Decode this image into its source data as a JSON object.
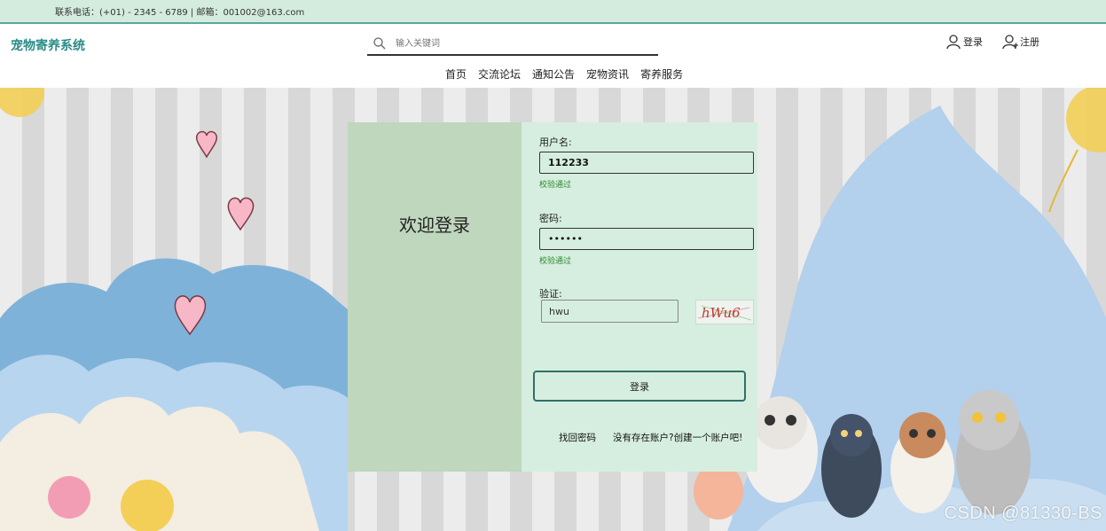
{
  "topbar": {
    "info": "联系电话：(+01) - 2345 - 6789 | 邮箱：001002@163.com"
  },
  "header": {
    "logo": "宠物寄养系统",
    "search_placeholder": "输入关键词",
    "login_label": "登录",
    "register_label": "注册"
  },
  "nav": [
    "首页",
    "交流论坛",
    "通知公告",
    "宠物资讯",
    "寄养服务"
  ],
  "card": {
    "welcome": "欢迎登录",
    "username_label": "用户名:",
    "username_value": "112233",
    "username_hint": "校验通过",
    "password_label": "密码:",
    "password_value": "••••••",
    "password_hint": "校验通过",
    "captcha_label": "验证:",
    "captcha_value": "hwu",
    "captcha_text": "hWu6",
    "login_button": "登录",
    "forgot_link": "找回密码",
    "register_link": "没有存在账户?创建一个账户吧!"
  },
  "watermark": "CSDN @81330-BS",
  "colors": {
    "brand": "#2a8c86",
    "topbar_bg": "#d4ecde",
    "card_left": "#bfd7bd",
    "card_right": "#d6eedf",
    "ok": "#2c8a2c"
  }
}
